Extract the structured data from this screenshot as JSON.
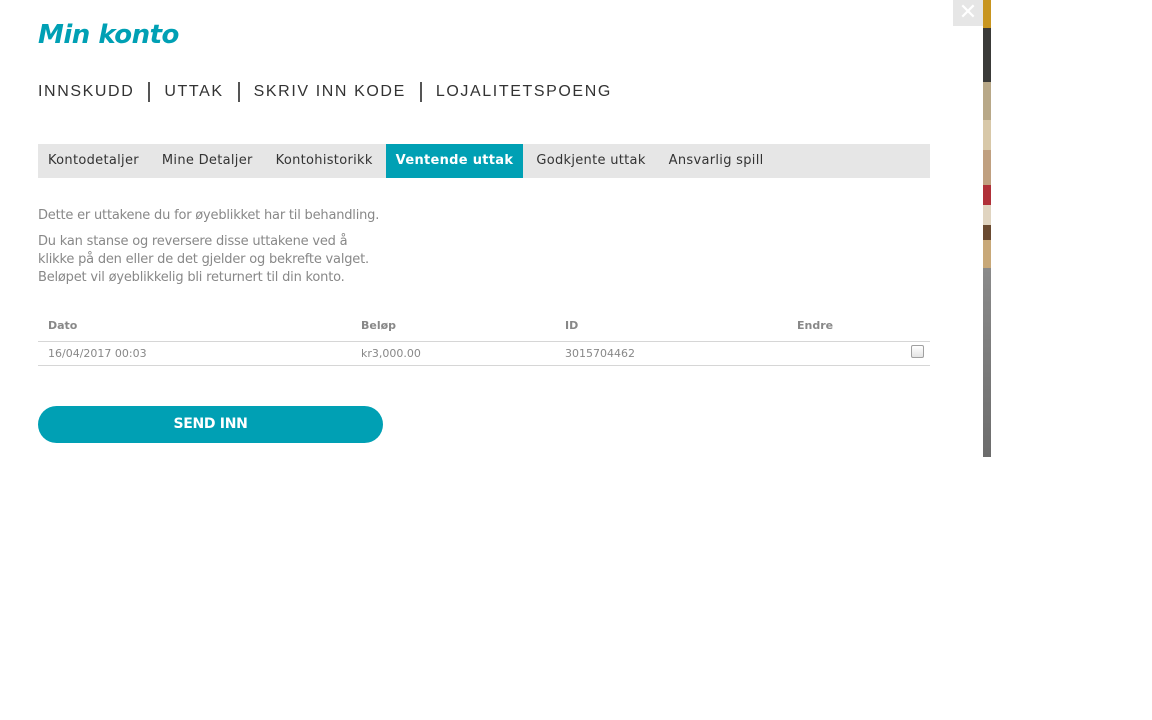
{
  "modal": {
    "title": "Min konto",
    "close_icon": "close-icon"
  },
  "topnav": {
    "items": [
      {
        "label": "INNSKUDD"
      },
      {
        "label": "UTTAK"
      },
      {
        "label": "SKRIV INN KODE"
      },
      {
        "label": "LOJALITETSPOENG"
      }
    ]
  },
  "tabs": {
    "items": [
      {
        "label": "Kontodetaljer"
      },
      {
        "label": "Mine Detaljer"
      },
      {
        "label": "Kontohistorikk"
      },
      {
        "label": "Ventende uttak",
        "active": true
      },
      {
        "label": "Godkjente uttak"
      },
      {
        "label": "Ansvarlig spill"
      }
    ]
  },
  "intro": {
    "line1": "Dette er uttakene du for øyeblikket har til behandling.",
    "line2": "Du kan stanse og reversere disse uttakene ved å klikke på den eller de det gjelder og bekrefte valget. Beløpet vil øyeblikkelig bli returnert til din konto."
  },
  "table": {
    "columns": [
      "Dato",
      "Beløp",
      "ID",
      "Endre"
    ],
    "rows": [
      {
        "dato": "16/04/2017 00:03",
        "belop": "kr3,000.00",
        "id": "3015704462",
        "checked": false
      }
    ]
  },
  "submit": {
    "label": "SEND INN"
  },
  "colors": {
    "accent": "#00a0b4",
    "tab_bg": "#e6e6e6",
    "muted_text": "#888888"
  }
}
